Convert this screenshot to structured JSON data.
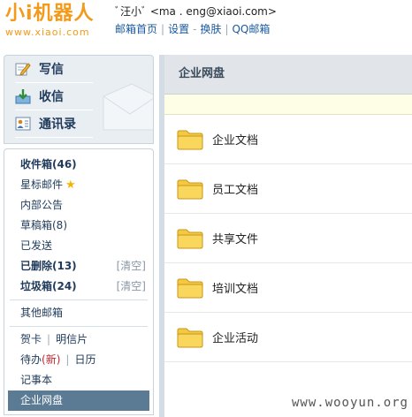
{
  "logo": {
    "main": "小i机器人",
    "sub": "www.xiaoi.com"
  },
  "user": {
    "line": "ﾞ汪小ﾞ <ma   . eng@xiaoi.com>"
  },
  "top_links": [
    "邮箱首页",
    "设置",
    "换肤",
    "QQ邮箱"
  ],
  "quick_actions": [
    {
      "label": "写信",
      "icon": "write-icon"
    },
    {
      "label": "收信",
      "icon": "inbox-download-icon"
    },
    {
      "label": "通讯录",
      "icon": "contacts-icon"
    }
  ],
  "folders": {
    "inbox": "收件箱(46)",
    "starred": "星标邮件",
    "notice": "内部公告",
    "drafts": "草稿箱(8)",
    "sent": "已发送",
    "deleted": "已删除(13)",
    "spam": "垃圾箱(24)",
    "clear": "[清空]",
    "other": "其他邮箱",
    "cards": "贺卡",
    "postcards": "明信片",
    "todo": "待办",
    "todo_new": "(新)",
    "calendar": "日历",
    "notes": "记事本",
    "netdisk": "企业网盘"
  },
  "main": {
    "title": "企业网盘",
    "files": [
      "企业文档",
      "员工文档",
      "共享文件",
      "培训文档",
      "企业活动"
    ]
  },
  "watermark": "www.wooyun.org",
  "colors": {
    "accent": "#f29a1b",
    "selected": "#5b7b95",
    "link": "#1a5aa0"
  }
}
